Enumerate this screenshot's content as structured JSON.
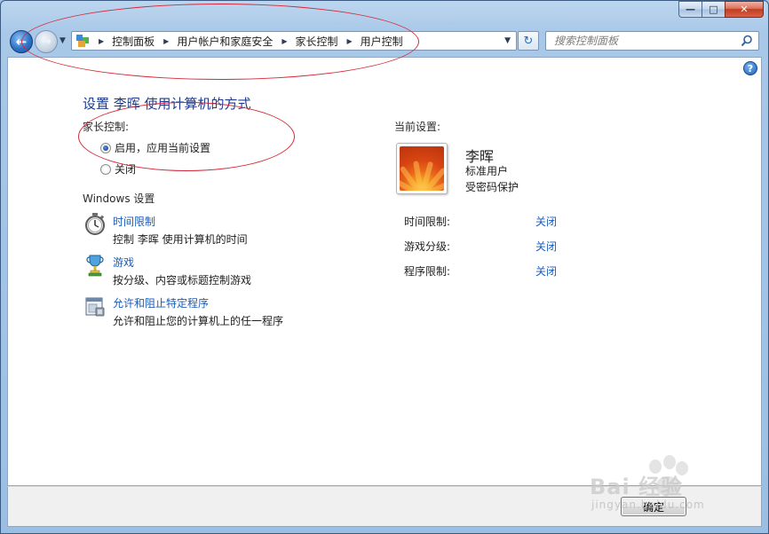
{
  "window": {
    "minimize_glyph": "—",
    "maximize_glyph": "□",
    "close_glyph": "✕"
  },
  "nav": {
    "back_glyph": "←",
    "forward_glyph": "→",
    "breadcrumb": [
      "控制面板",
      "用户帐户和家庭安全",
      "家长控制",
      "用户控制"
    ],
    "refresh_glyph": "↻"
  },
  "search": {
    "placeholder": "搜索控制面板"
  },
  "help": {
    "glyph": "?"
  },
  "page": {
    "title": "设置 李晖 使用计算机的方式",
    "parental_label": "家长控制:",
    "options": [
      {
        "label": "启用，应用当前设置",
        "checked": true
      },
      {
        "label": "关闭",
        "checked": false
      }
    ],
    "windows_settings_label": "Windows 设置",
    "settings": [
      {
        "link": "时间限制",
        "desc": "控制 李晖 使用计算机的时间",
        "icon": "stopwatch-icon"
      },
      {
        "link": "游戏",
        "desc": "按分级、内容或标题控制游戏",
        "icon": "trophy-icon"
      },
      {
        "link": "允许和阻止特定程序",
        "desc": "允许和阻止您的计算机上的任一程序",
        "icon": "program-icon"
      }
    ]
  },
  "current": {
    "label": "当前设置:",
    "user_name": "李晖",
    "account_type": "标准用户",
    "password_status": "受密码保护",
    "rows": [
      {
        "label": "时间限制:",
        "value": "关闭"
      },
      {
        "label": "游戏分级:",
        "value": "关闭"
      },
      {
        "label": "程序限制:",
        "value": "关闭"
      }
    ]
  },
  "footer": {
    "ok_label": "确定"
  },
  "watermark": {
    "brand": "Bai  经验",
    "url": "jingyan.baidu.com"
  },
  "colors": {
    "link": "#1d5bb5",
    "title": "#1e3b8c",
    "annotation": "#d6283a"
  }
}
